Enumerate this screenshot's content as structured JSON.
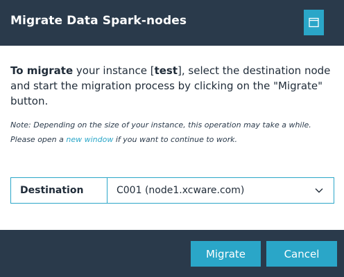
{
  "dialog": {
    "title": "Migrate Data Spark-nodes",
    "window_icon": "window-icon"
  },
  "intro": {
    "lead_bold": "To migrate",
    "text_1": " your instance [",
    "instance_name": "test",
    "text_2": "], select the destination node and start the migration process by clicking on the \"Migrate\" button."
  },
  "note": {
    "text_1": "Note: Depending on the size of your instance, this operation may take a while. Please open a ",
    "link_label": "new window",
    "text_2": " if you want to continue to work."
  },
  "destination": {
    "label": "Destination",
    "selected_value": "C001 (node1.xcware.com)",
    "icon": "chevron-down-icon"
  },
  "footer": {
    "migrate_label": "Migrate",
    "cancel_label": "Cancel"
  },
  "colors": {
    "header_bg": "#2a3a4b",
    "accent": "#2aa6c8",
    "text": "#1f2b38"
  }
}
